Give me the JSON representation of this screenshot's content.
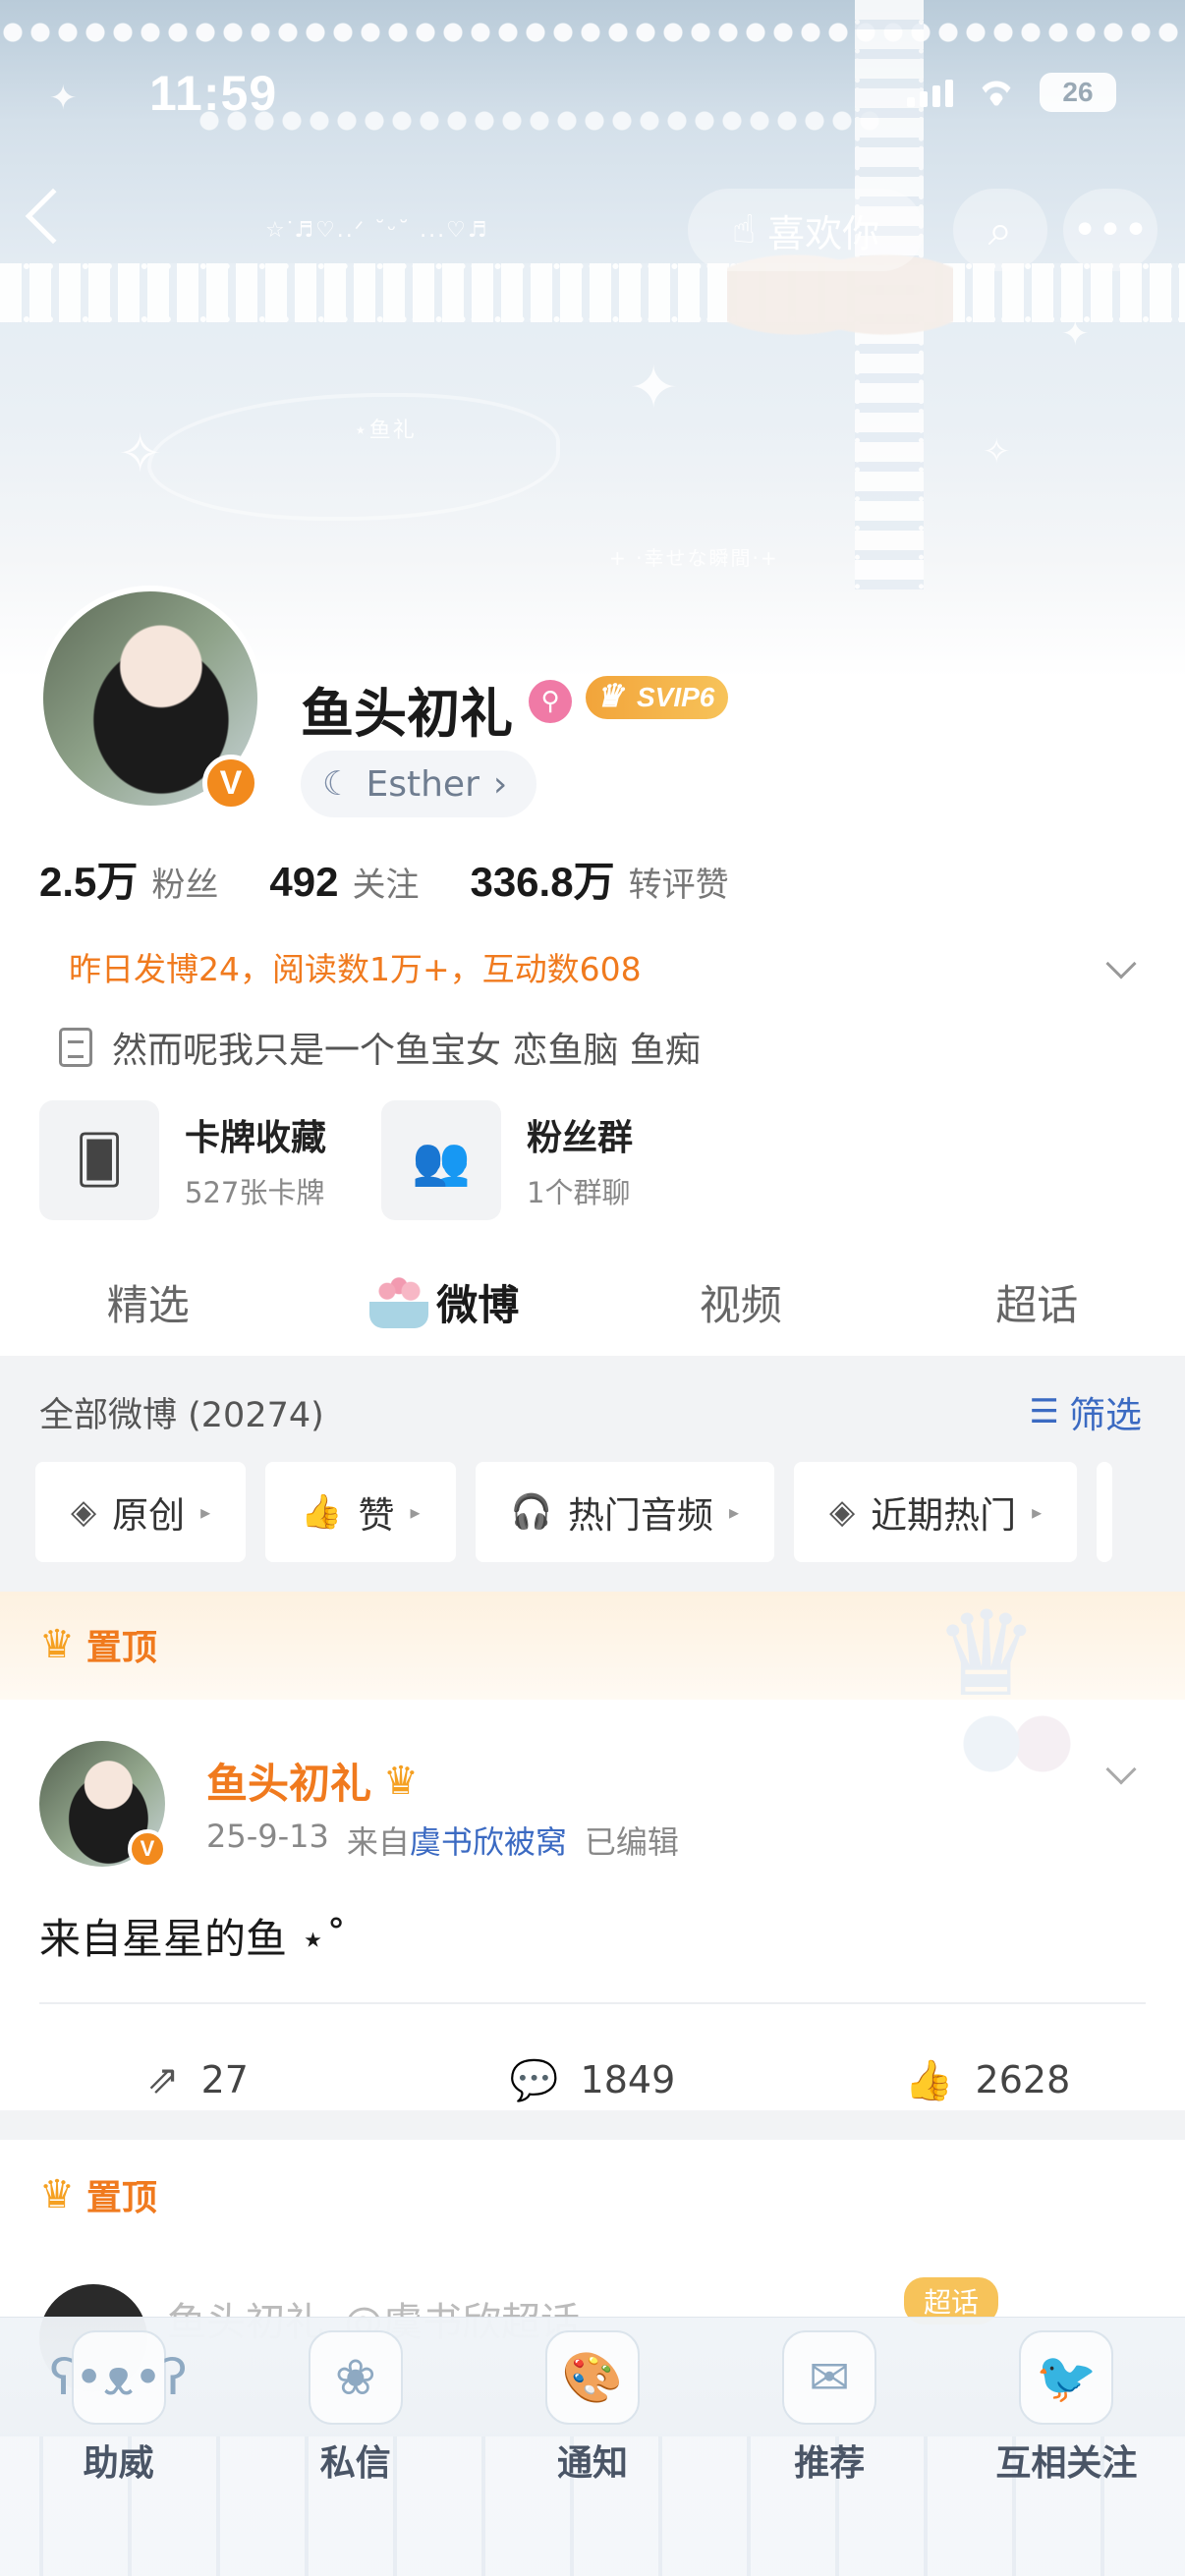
{
  "status_bar": {
    "time": "11:59",
    "battery": "26"
  },
  "header": {
    "like_label": "喜欢你",
    "sticker_text_1": "☆ᐝ♬♡..ᐟ ˘ᵕ˘ ...♡♬",
    "sticker_text_2": "⋆鱼礼",
    "sticker_text_3": "+ ·幸せな瞬間·+"
  },
  "profile": {
    "name": "鱼头初礼",
    "vip_label": "SVIP6",
    "verified": "V",
    "sub_account": "Esther",
    "stats": [
      {
        "num": "2.5万",
        "label": "粉丝"
      },
      {
        "num": "492",
        "label": "关注"
      },
      {
        "num": "336.8万",
        "label": "转评赞"
      }
    ],
    "activity": "昨日发博24，阅读数1万+，互动数608",
    "bio": "然而呢我只是一个鱼宝女 恋鱼脑 鱼痴",
    "cards": [
      {
        "title": "卡牌收藏",
        "sub": "527张卡牌",
        "icon": "card-icon"
      },
      {
        "title": "粉丝群",
        "sub": "1个群聊",
        "icon": "group-icon"
      }
    ]
  },
  "tabs": [
    "精选",
    "微博",
    "视频",
    "超话"
  ],
  "feed": {
    "title": "全部微博 (20274)",
    "filter_label": "筛选",
    "chips": [
      {
        "label": "原创",
        "icon": "layers-icon"
      },
      {
        "label": "赞",
        "icon": "thumb-icon"
      },
      {
        "label": "热门音频",
        "icon": "headphone-icon"
      },
      {
        "label": "近期热门",
        "icon": "layers-icon"
      }
    ]
  },
  "pinned_label": "置顶",
  "post": {
    "author": "鱼头初礼",
    "date": "25-9-13",
    "from_prefix": "来自",
    "source": "虞书欣被窝",
    "edited": "已编辑",
    "text": "来自星星的鱼 ⋆˚",
    "reposts": "27",
    "comments": "1849",
    "likes": "2628"
  },
  "pinned_label_2": "置顶",
  "peek": {
    "author": "鱼头初礼",
    "mention": "@虞书欣超话",
    "badge": "超话"
  },
  "bottom_bar": [
    {
      "label": "助威",
      "icon": "bear-icon"
    },
    {
      "label": "私信",
      "icon": "rose-dome-icon"
    },
    {
      "label": "通知",
      "icon": "palette-icon"
    },
    {
      "label": "推荐",
      "icon": "stamp-icon"
    },
    {
      "label": "互相关注",
      "icon": "bird-icon"
    }
  ]
}
